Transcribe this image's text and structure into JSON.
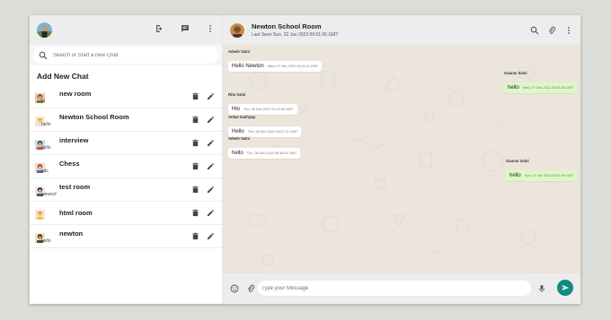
{
  "sidebar": {
    "search_placeholder": "Search or Start a new Chat",
    "add_new_chat": "Add New Chat",
    "rooms": [
      {
        "name": "new room",
        "last": "hi"
      },
      {
        "name": "Newton School Room",
        "last": "hello"
      },
      {
        "name": "interview",
        "last": "hello"
      },
      {
        "name": "Chess",
        "last": "sds"
      },
      {
        "name": "test room",
        "last": "wewecf"
      },
      {
        "name": "html room",
        "last": ""
      },
      {
        "name": "newton",
        "last": "hello"
      }
    ]
  },
  "chat": {
    "title": "Newton School Room",
    "subtitle": "Last Seen Sun, 22 Jan 2023 09:01:06 GMT",
    "messages": [
      {
        "sender": "Adesh Saini",
        "text": "Hello Newton",
        "time": "Wed, 07 Dec 2022 23:02:11 GMT",
        "out": false
      },
      {
        "sender": "Gaurav Saini",
        "text": "hello",
        "time": "Wed, 07 Dec 2022 23:05:38 GMT",
        "out": true
      },
      {
        "sender": "Ritu Saini",
        "text": "Hlo",
        "time": "Thu, 08 Dec 2022 01:15:56 GMT",
        "out": false
      },
      {
        "sender": "Ankur kashyap",
        "text": "Hello",
        "time": "Thu, 08 Dec 2022 04:27:21 GMT",
        "out": false
      },
      {
        "sender": "Adesh Saini",
        "text": "hello",
        "time": "Thu, 08 Dec 2022 08:48:51 GMT",
        "out": false
      },
      {
        "sender": "Gaurav Saini",
        "text": "hello",
        "time": "Sun, 22 Jan 2023 09:01:06 GMT",
        "out": true
      }
    ],
    "input_placeholder": "Type your Message"
  },
  "colors": {
    "header_bg": "#ededed",
    "chat_bg": "#ece5dc",
    "outgoing_bubble": "#dcf8c6",
    "send_button": "#128c7e"
  },
  "icons": {
    "search": "search-icon",
    "logout": "logout-icon",
    "new_chat": "message-icon",
    "menu": "more-vert-icon",
    "delete": "trash-icon",
    "edit": "pencil-icon",
    "attach": "attach-icon",
    "emoji": "emoji-icon",
    "mic": "mic-icon",
    "send": "send-icon"
  }
}
